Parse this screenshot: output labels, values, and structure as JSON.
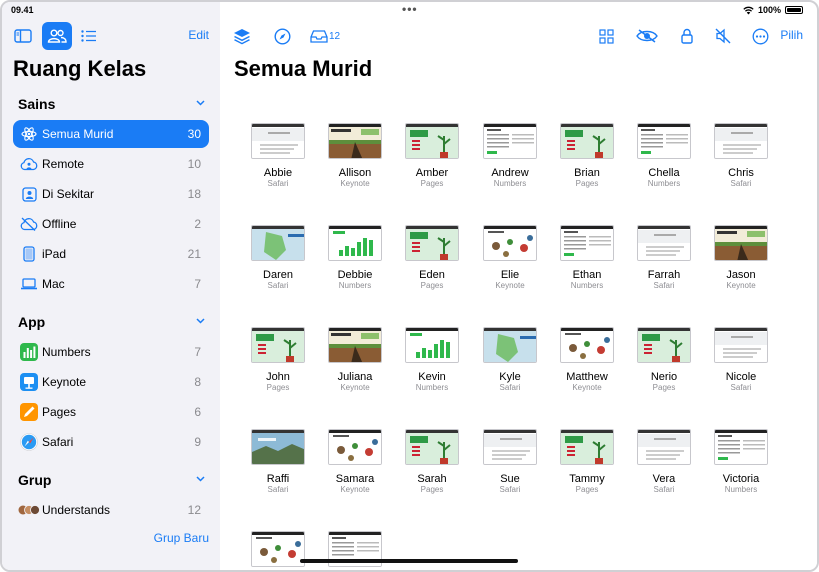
{
  "status": {
    "time": "09.41",
    "battery": "100%"
  },
  "sidebar": {
    "edit_label": "Edit",
    "title": "Ruang Kelas",
    "sections": [
      {
        "label": "Sains",
        "items": [
          {
            "label": "Semua Murid",
            "count": "30",
            "icon": "atom-icon",
            "selected": true
          },
          {
            "label": "Remote",
            "count": "10",
            "icon": "cloud-person-icon"
          },
          {
            "label": "Di Sekitar",
            "count": "18",
            "icon": "person-square-icon"
          },
          {
            "label": "Offline",
            "count": "2",
            "icon": "cloud-slash-icon"
          },
          {
            "label": "iPad",
            "count": "21",
            "icon": "ipad-icon"
          },
          {
            "label": "Mac",
            "count": "7",
            "icon": "laptop-icon"
          }
        ]
      },
      {
        "label": "App",
        "items": [
          {
            "label": "Numbers",
            "count": "7",
            "icon": "numbers-app-icon"
          },
          {
            "label": "Keynote",
            "count": "8",
            "icon": "keynote-app-icon"
          },
          {
            "label": "Pages",
            "count": "6",
            "icon": "pages-app-icon"
          },
          {
            "label": "Safari",
            "count": "9",
            "icon": "safari-app-icon"
          }
        ]
      },
      {
        "label": "Grup",
        "items": [
          {
            "label": "Understands",
            "count": "12",
            "icon": "group-avatars-icon"
          }
        ]
      }
    ],
    "new_group_label": "Grup Baru"
  },
  "toolbar": {
    "inbox_count": "12",
    "select_label": "Pilih"
  },
  "main": {
    "title": "Semua Murid",
    "students": [
      {
        "name": "Abbie",
        "app": "Safari"
      },
      {
        "name": "Allison",
        "app": "Keynote"
      },
      {
        "name": "Amber",
        "app": "Pages"
      },
      {
        "name": "Andrew",
        "app": "Numbers"
      },
      {
        "name": "Brian",
        "app": "Pages"
      },
      {
        "name": "Chella",
        "app": "Numbers"
      },
      {
        "name": "Chris",
        "app": "Safari"
      },
      {
        "name": "Daren",
        "app": "Safari"
      },
      {
        "name": "Debbie",
        "app": "Numbers"
      },
      {
        "name": "Eden",
        "app": "Pages"
      },
      {
        "name": "Elie",
        "app": "Keynote"
      },
      {
        "name": "Ethan",
        "app": "Numbers"
      },
      {
        "name": "Farrah",
        "app": "Safari"
      },
      {
        "name": "Jason",
        "app": "Keynote"
      },
      {
        "name": "John",
        "app": "Pages"
      },
      {
        "name": "Juliana",
        "app": "Keynote"
      },
      {
        "name": "Kevin",
        "app": "Numbers"
      },
      {
        "name": "Kyle",
        "app": "Safari"
      },
      {
        "name": "Matthew",
        "app": "Keynote"
      },
      {
        "name": "Nerio",
        "app": "Pages"
      },
      {
        "name": "Nicole",
        "app": "Safari"
      },
      {
        "name": "Raffi",
        "app": "Safari"
      },
      {
        "name": "Samara",
        "app": "Keynote"
      },
      {
        "name": "Sarah",
        "app": "Pages"
      },
      {
        "name": "Sue",
        "app": "Safari"
      },
      {
        "name": "Tammy",
        "app": "Pages"
      },
      {
        "name": "Vera",
        "app": "Safari"
      },
      {
        "name": "Victoria",
        "app": "Numbers"
      },
      {
        "name": "",
        "app": ""
      },
      {
        "name": "",
        "app": ""
      }
    ]
  },
  "colors": {
    "accent": "#1a7cf5",
    "sidebar_bg": "#f2f2f7"
  }
}
